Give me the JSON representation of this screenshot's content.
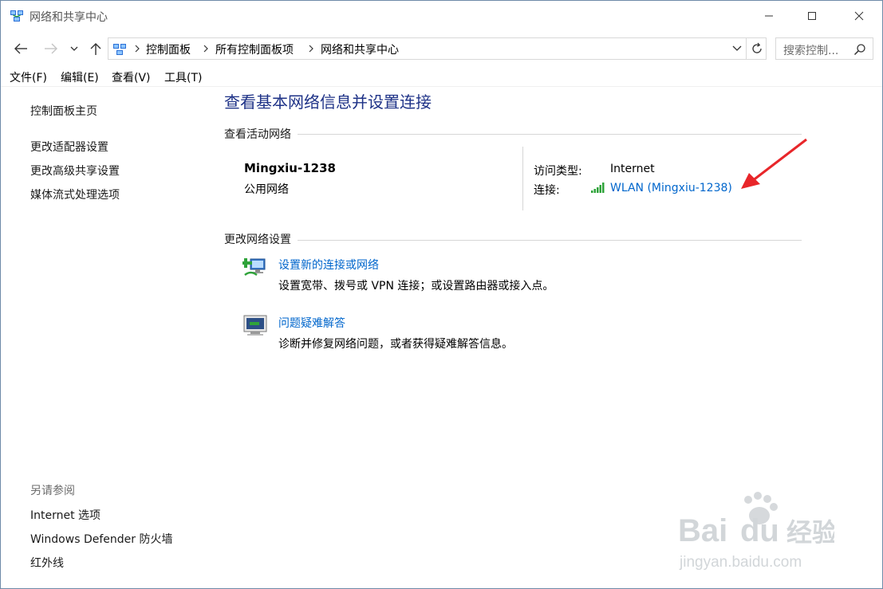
{
  "window": {
    "title": "网络和共享中心"
  },
  "address_bar": {
    "breadcrumbs": [
      "控制面板",
      "所有控制面板项",
      "网络和共享中心"
    ]
  },
  "search": {
    "placeholder": "搜索控制..."
  },
  "menu": [
    "文件(F)",
    "编辑(E)",
    "查看(V)",
    "工具(T)"
  ],
  "sidebar": {
    "home": "控制面板主页",
    "items": [
      "更改适配器设置",
      "更改高级共享设置",
      "媒体流式处理选项"
    ],
    "see_also_heading": "另请参阅",
    "see_also": [
      "Internet 选项",
      "Windows Defender 防火墙",
      "红外线"
    ]
  },
  "main": {
    "title": "查看基本网络信息并设置连接",
    "active_heading": "查看活动网络",
    "network_name": "Mingxiu-1238",
    "network_category": "公用网络",
    "access_type_label": "访问类型:",
    "access_type_value": "Internet",
    "connections_label": "连接:",
    "connection_link": "WLAN (Mingxiu-1238)",
    "change_heading": "更改网络设置",
    "tasks": [
      {
        "link": "设置新的连接或网络",
        "desc": "设置宽带、拨号或 VPN 连接；或设置路由器或接入点。",
        "icon": "network-setup-icon"
      },
      {
        "link": "问题疑难解答",
        "desc": "诊断并修复网络问题，或者获得疑难解答信息。",
        "icon": "troubleshoot-icon"
      }
    ]
  },
  "colors": {
    "title_blue": "#1e3287",
    "link_blue": "#0066cc",
    "annotation_red": "#e8262a"
  }
}
